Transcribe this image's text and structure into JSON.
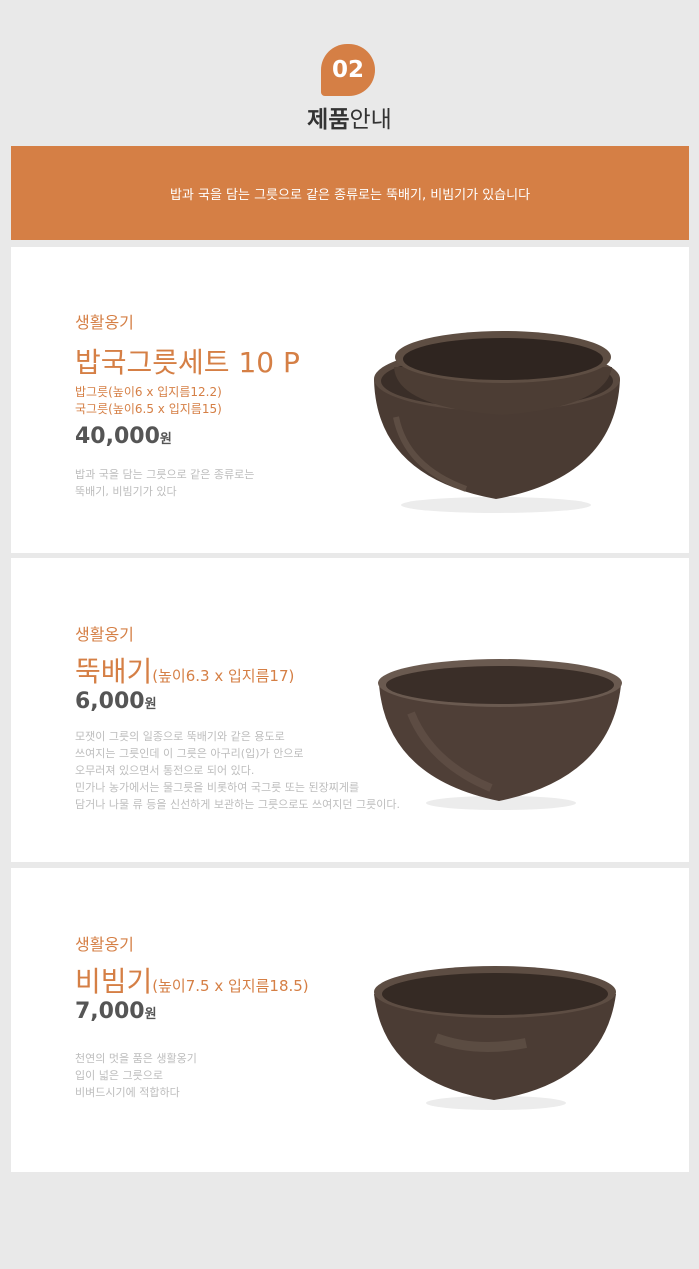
{
  "header": {
    "badge_number": "02",
    "title_bold": "제품",
    "title_light": "안내"
  },
  "banner": {
    "text": "밥과 국을 담는 그릇으로 같은 종류로는 뚝배기, 비빔기가 있습니다"
  },
  "products": [
    {
      "category": "생활옹기",
      "name": "밥국그릇세트 10 P",
      "dimensions": "",
      "sub_lines": [
        "밥그릇(높이6 x 입지름12.2)",
        "국그릇(높이6.5 x 입지름15)"
      ],
      "price": "40,000",
      "currency": "원",
      "description": [
        "밥과 국을 담는 그릇으로 같은 종류로는",
        "뚝배기, 비빔기가 있다"
      ]
    },
    {
      "category": "생활옹기",
      "name": "뚝배기",
      "dimensions": "(높이6.3 x 입지름17)",
      "price": "6,000",
      "currency": "원",
      "description": [
        "모잿이 그릇의 일종으로 뚝배기와 같은 용도로",
        "쓰여지는 그릇인데 이 그릇은 아구리(입)가 안으로",
        "오무러져 있으면서 통전으로 되어 있다.",
        "민가나 농가에서는 물그릇을 비롯하여 국그릇 또는 된장찌게를",
        "담거나 나물 류 등을 신선하게 보관하는 그릇으로도 쓰여지던 그릇이다."
      ]
    },
    {
      "category": "생활옹기",
      "name": "비빔기",
      "dimensions": "(높이7.5 x 입지름18.5)",
      "price": "7,000",
      "currency": "원",
      "description": [
        "천연의 멋을 품은 생활옹기",
        "입이 넓은 그릇으로",
        "비벼드시기에 적합하다"
      ]
    }
  ],
  "colors": {
    "accent": "#d57f45",
    "background": "#e9e9e9",
    "card": "#ffffff",
    "bowl": "#4a3b33"
  }
}
